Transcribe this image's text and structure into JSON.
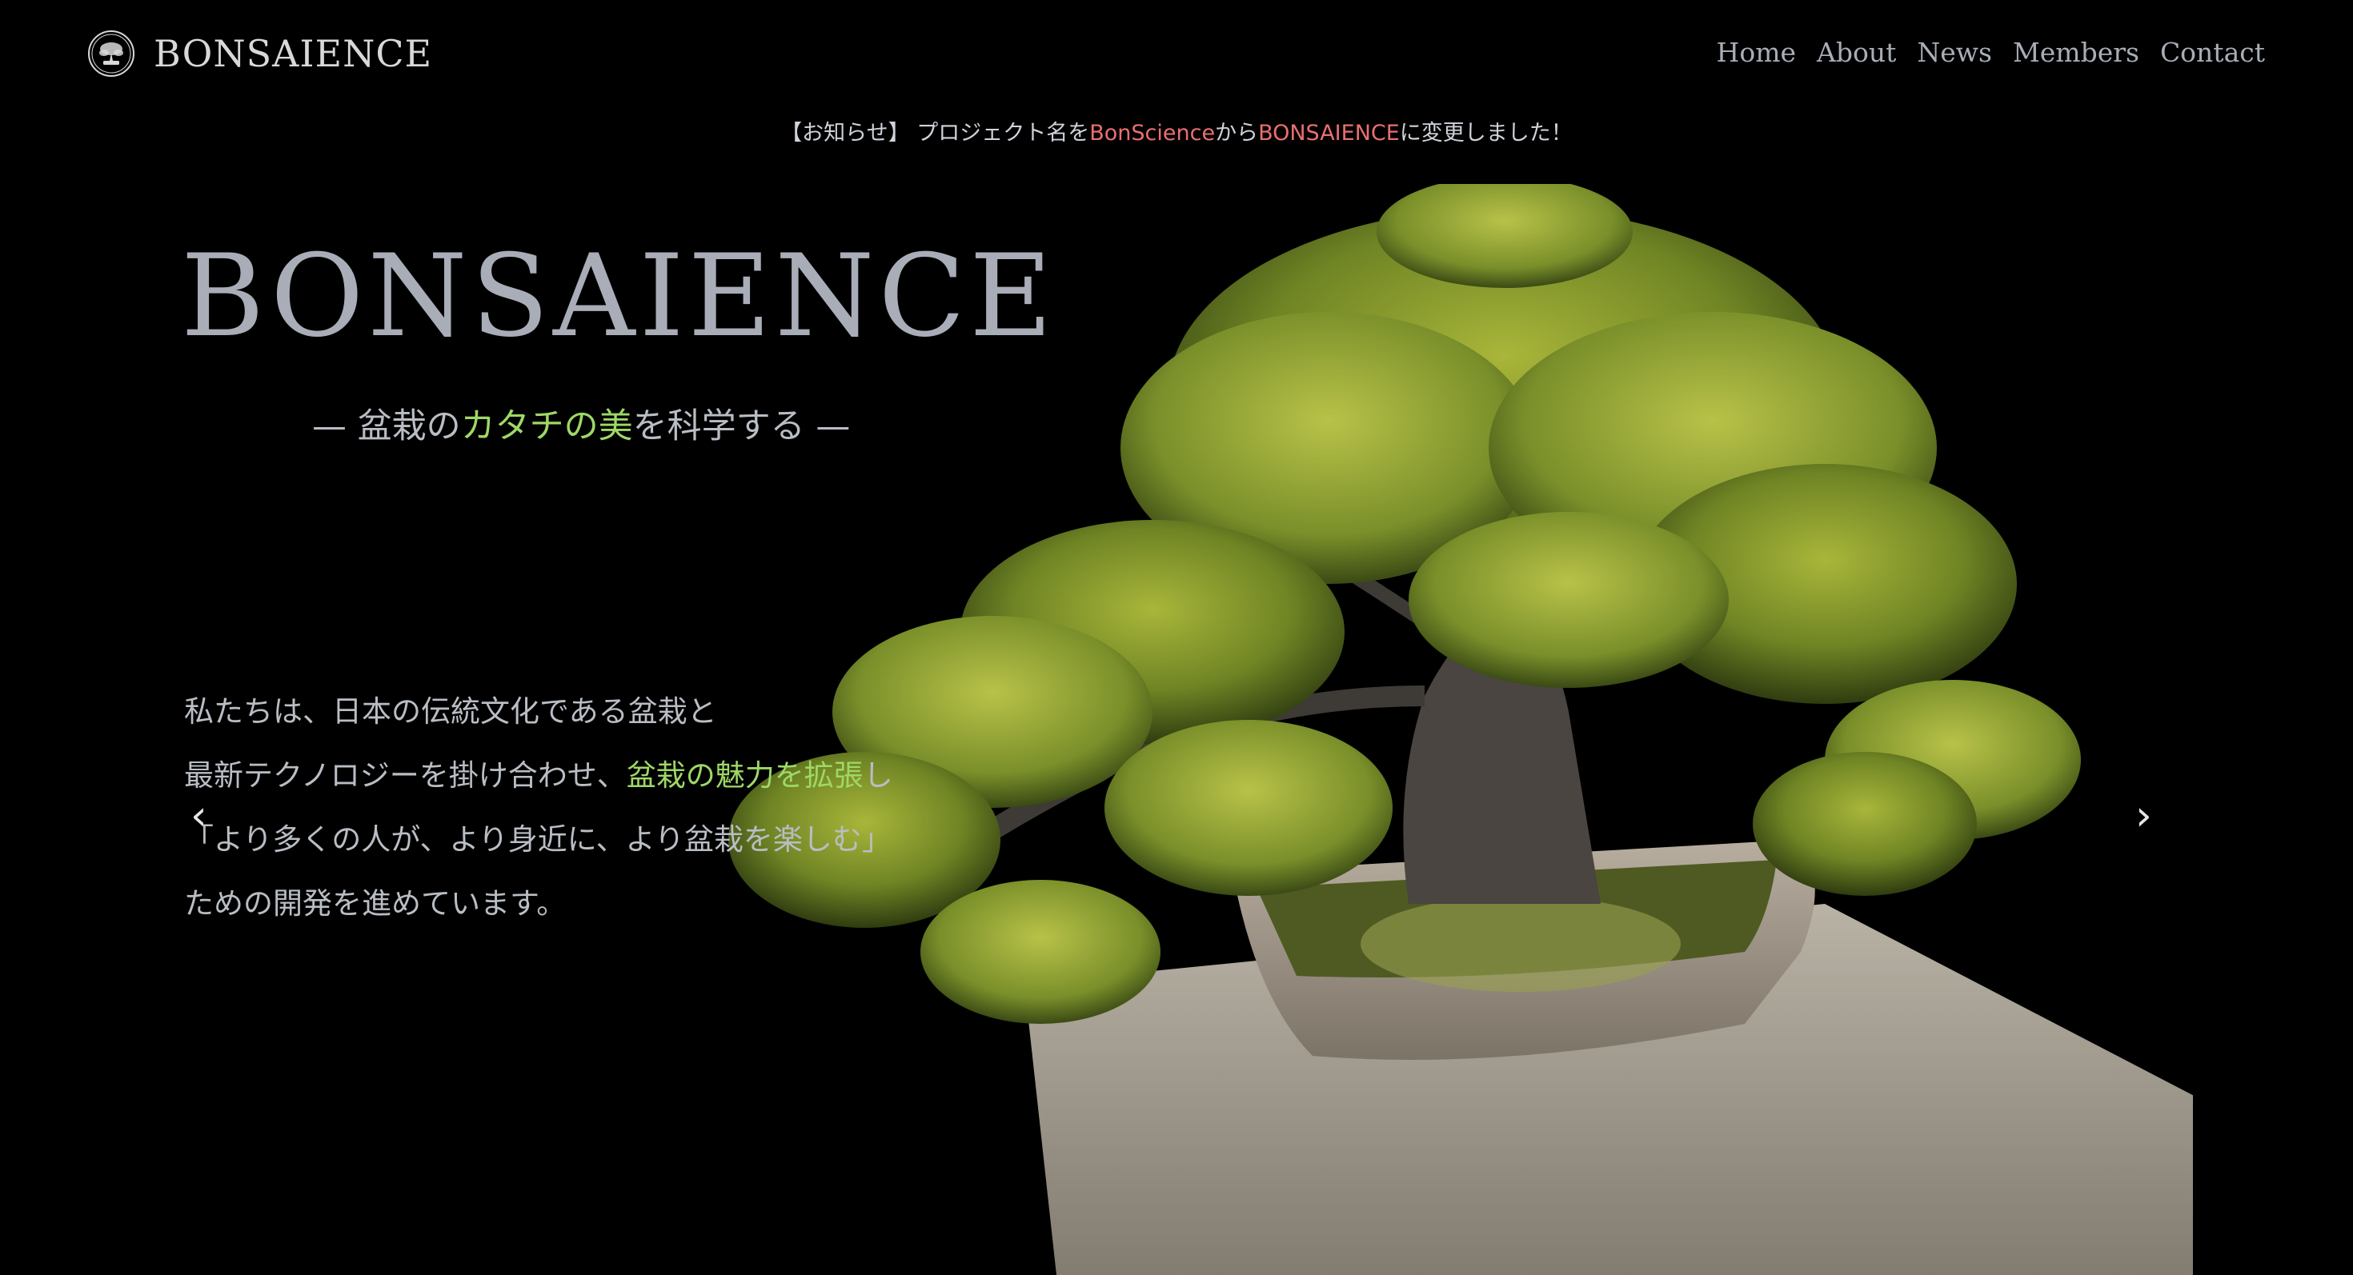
{
  "header": {
    "brand_name": "BONSAIENCE",
    "logo_icon": "bonsai-tree-logo-icon",
    "nav": [
      {
        "label": "Home"
      },
      {
        "label": "About"
      },
      {
        "label": "News"
      },
      {
        "label": "Members"
      },
      {
        "label": "Contact"
      }
    ]
  },
  "notice": {
    "prefix": "【お知らせ】 プロジェクト名を",
    "old_name": "BonScience",
    "middle": "から",
    "new_name": "BONSAIENCE",
    "suffix": "に変更しました！"
  },
  "hero": {
    "title": "BONSAIENCE",
    "tagline": {
      "before": "— 盆栽の",
      "highlight": "カタチの美",
      "after": "を科学する —"
    },
    "description": {
      "line1": "私たちは、日本の伝統文化である盆栽と",
      "line2_before": "最新テクノロジーを掛け合わせ、",
      "line2_highlight": "盆栽の魅力を拡張",
      "line2_after": "し",
      "line3": "「より多くの人が、より身近に、より盆栽を楽しむ」",
      "line4": "ための開発を進めています。"
    },
    "carousel": {
      "prev_icon": "chevron-left-icon",
      "next_icon": "chevron-right-icon",
      "prev_glyph": "‹",
      "next_glyph": "›"
    }
  },
  "colors": {
    "background": "#000000",
    "highlight_green": "#9ed866",
    "highlight_red": "#e8706f",
    "text_grey": "#a9adb7"
  }
}
